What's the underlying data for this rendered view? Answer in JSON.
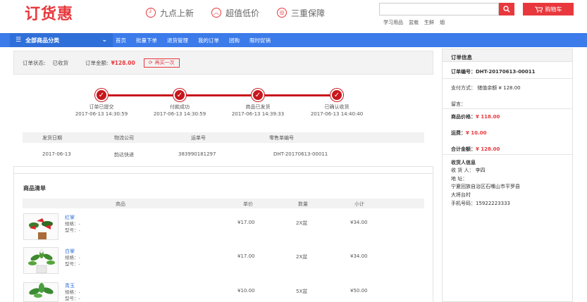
{
  "header": {
    "logo_text": "订货惠",
    "features": [
      {
        "icon": "clock-icon",
        "glyph": "┘",
        "label": "九点上新"
      },
      {
        "icon": "price-icon",
        "glyph": "︿",
        "label": "超值低价"
      },
      {
        "icon": "shield-icon",
        "glyph": "◎",
        "label": "三重保障"
      }
    ],
    "search_placeholder": "",
    "cart_label": "购物车",
    "hot_words": [
      "学习用品",
      "盆栽",
      "生鲜",
      "烟"
    ]
  },
  "nav": {
    "category_label": "全部商品分类",
    "links": [
      "首页",
      "批量下单",
      "退货管理",
      "我的订单",
      "团购",
      "限时促销"
    ]
  },
  "order_status": {
    "status_label": "订单状态:",
    "status_value": "已收货",
    "amount_label": "订单金额:",
    "amount_value": "¥128.00",
    "rebuy_label": "再买一次"
  },
  "timeline": [
    {
      "label": "订单已提交",
      "time": "2017-06-13 14:30:59"
    },
    {
      "label": "付款成功",
      "time": "2017-06-13 14:30:59"
    },
    {
      "label": "商品已发货",
      "time": "2017-06-13 14:39:33"
    },
    {
      "label": "已确认收货",
      "time": "2017-06-13 14:40:40"
    }
  ],
  "shipping": {
    "headers": [
      "发货日期",
      "物流公司",
      "运单号",
      "零售单编号"
    ],
    "row": [
      "2017-06-13",
      "韵达快递",
      "383990181297",
      "DHT-20170613-00011"
    ]
  },
  "goods": {
    "title": "商品清单",
    "headers": [
      "商品",
      "单价",
      "数量",
      "小计"
    ],
    "spec_label": "规格：-",
    "model_label": "型号：-",
    "items": [
      {
        "name": "红掌",
        "price": "¥17.00",
        "qty": "2X盆",
        "subtotal": "¥34.00"
      },
      {
        "name": "白掌",
        "price": "¥17.00",
        "qty": "2X盆",
        "subtotal": "¥34.00"
      },
      {
        "name": "青玉",
        "price": "¥10.00",
        "qty": "5X盆",
        "subtotal": "¥50.00"
      }
    ]
  },
  "order_info": {
    "title": "订单信息",
    "order_no": "订单编号：DHT-20170613-00011",
    "payment": "支付方式： 储值余额 ¥ 128.00",
    "remark": "留言：",
    "goods_price_label": "商品价格：",
    "goods_price": "¥ 118.00",
    "freight_label": "运费：",
    "freight": "¥ 10.00",
    "total_label": "合计金额：",
    "total": "¥ 128.00",
    "receiver_title": "收货人信息",
    "receiver_name": "收 货 人： 李四",
    "address_label": "地      址：",
    "address_line1": "宁夏回族自治区石嘴山市平罗县",
    "address_line2": "大将台村",
    "phone": "手机号码：15922223333"
  },
  "colors": {
    "accent": "#e8383d",
    "nav": "#3b7bea",
    "timeline": "#c8161d"
  }
}
